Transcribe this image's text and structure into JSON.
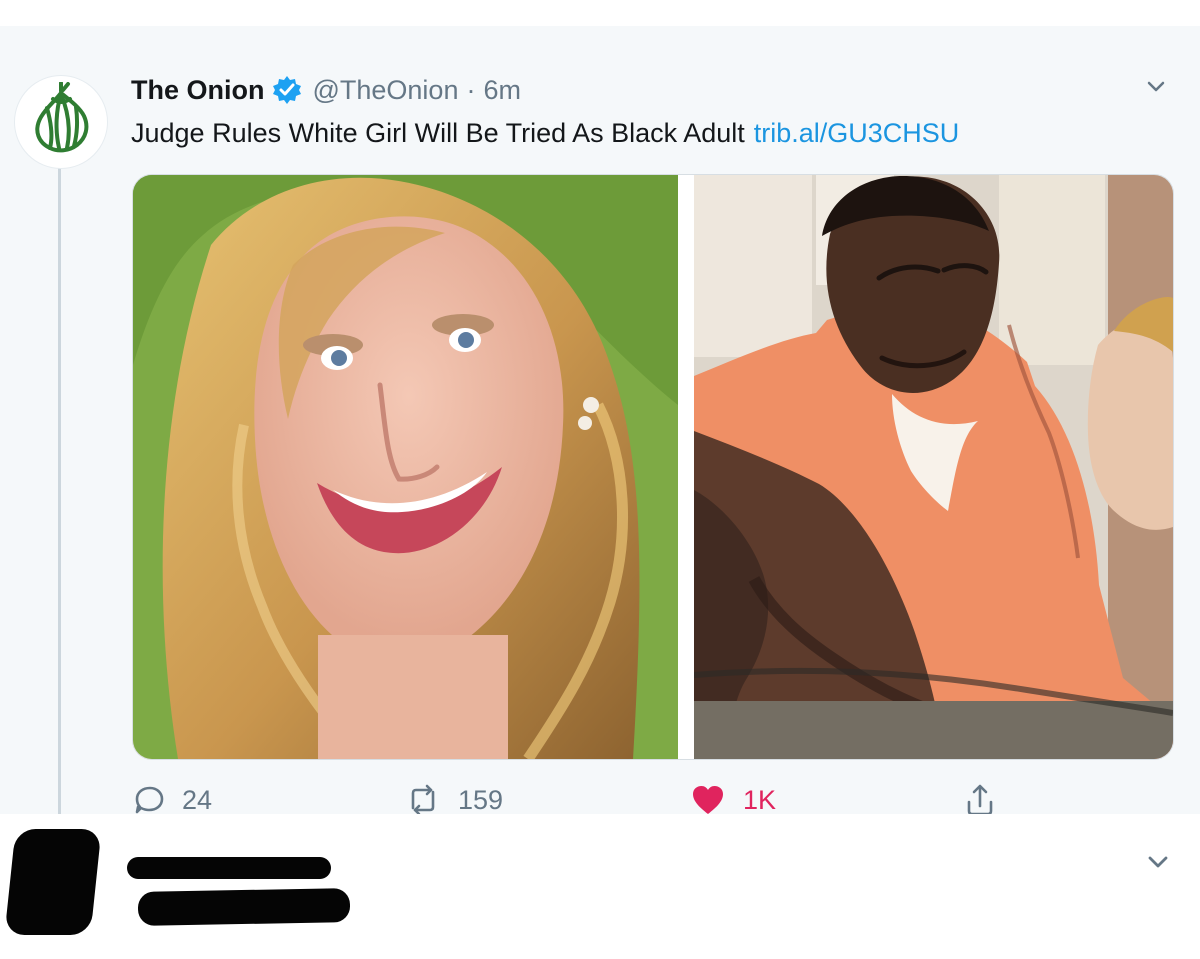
{
  "tweet": {
    "author_name": "The Onion",
    "handle": "@TheOnion",
    "separator": "·",
    "time": "6m",
    "text": "Judge Rules White Girl Will Be Tried As Black Adult",
    "link_text": "trib.al/GU3CHSU",
    "icons": {
      "avatar": "onion-logo-icon",
      "verified": "verified-badge-icon",
      "menu": "chevron-down-icon"
    },
    "media": {
      "left_image": "smiling-young-woman-portrait-photo",
      "right_image": "courtroom-sketch-man-orange-jumpsuit"
    },
    "actions": {
      "reply_count": "24",
      "retweet_count": "159",
      "like_count": "1K",
      "share": "share-icon"
    }
  },
  "reply": {
    "menu_icon": "chevron-down-icon",
    "redacted": true
  },
  "colors": {
    "background": "#f5f8fa",
    "text": "#14171a",
    "secondary_text": "#657786",
    "link": "#1b95e0",
    "like": "#e0245e",
    "verified": "#1da1f2"
  }
}
